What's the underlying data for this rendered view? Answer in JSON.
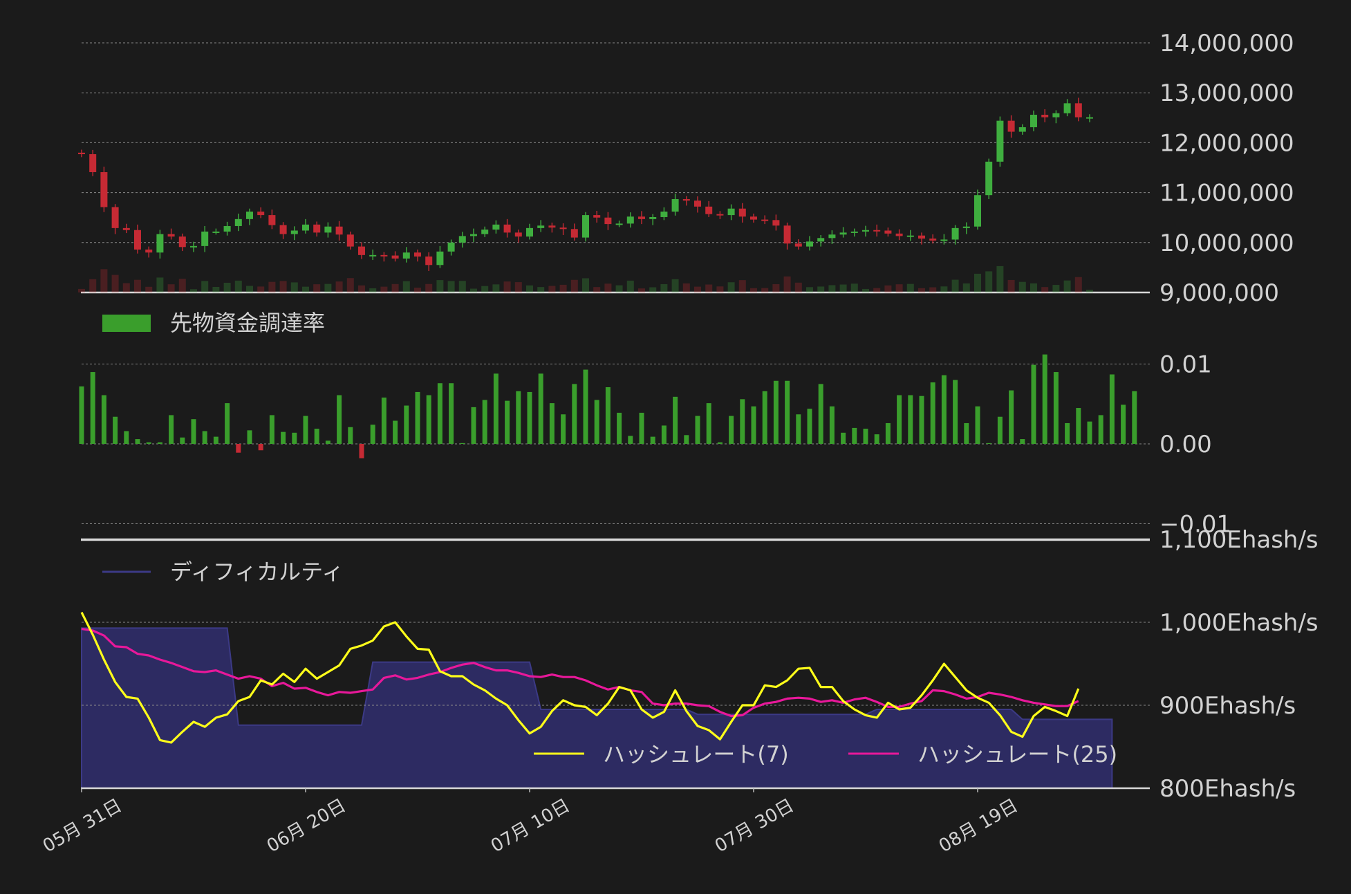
{
  "colors": {
    "background": "#1b1b1b",
    "up": "#3fae3f",
    "down": "#c62a34",
    "funding": "#3a9e2c",
    "difficulty_fill": "#2d2b62",
    "difficulty_line": "#3c3a86",
    "hash7": "#ffff1a",
    "hash25": "#e8189a"
  },
  "chart_data": [
    {
      "type": "candlestick",
      "x": {
        "start": "05月 31日",
        "count": 91
      },
      "y_ticks": [
        "9,000,000",
        "10,000,000",
        "11,000,000",
        "12,000,000",
        "13,000,000",
        "14,000,000"
      ],
      "ylim": [
        9000000,
        14000000
      ],
      "grid": true,
      "ohlc_close": [
        11770000,
        11410000,
        10710000,
        10290000,
        10250000,
        9860000,
        9800000,
        10170000,
        10120000,
        9910000,
        9930000,
        10220000,
        10220000,
        10330000,
        10470000,
        10620000,
        10550000,
        10350000,
        10170000,
        10240000,
        10360000,
        10200000,
        10320000,
        10160000,
        9920000,
        9750000,
        9750000,
        9740000,
        9680000,
        9800000,
        9720000,
        9550000,
        9820000,
        10000000,
        10130000,
        10170000,
        10260000,
        10360000,
        10200000,
        10120000,
        10290000,
        10340000,
        10300000,
        10270000,
        10100000,
        10550000,
        10500000,
        10370000,
        10380000,
        10520000,
        10470000,
        10510000,
        10620000,
        10870000,
        10840000,
        10720000,
        10570000,
        10550000,
        10680000,
        10520000,
        10460000,
        10450000,
        10340000,
        9980000,
        9920000,
        10020000,
        10090000,
        10160000,
        10200000,
        10220000,
        10250000,
        10240000,
        10180000,
        10130000,
        10140000,
        10080000,
        10040000,
        10060000,
        10290000,
        10320000,
        10950000,
        11620000,
        12440000,
        12220000,
        12310000,
        12560000,
        12510000,
        12590000,
        12790000,
        12510000,
        12510000
      ]
    },
    {
      "type": "bar",
      "legend": "先物資金調達率",
      "y_ticks": [
        "−0.01",
        "0.00",
        "0.01"
      ],
      "ylim": [
        -0.01,
        0.01
      ],
      "values": [
        0.0072,
        0.009,
        0.0061,
        0.0034,
        0.0016,
        0.0006,
        0.0002,
        0.0002,
        0.0036,
        0.0008,
        0.0031,
        0.0016,
        0.0009,
        0.0051,
        -0.0011,
        0.0017,
        -0.0008,
        0.0036,
        0.0015,
        0.0014,
        0.0035,
        0.0019,
        0.0004,
        0.0061,
        0.0021,
        -0.0018,
        0.0024,
        0.0058,
        0.0029,
        0.0048,
        0.0065,
        0.0061,
        0.0076,
        0.0076,
        0.0001,
        0.0046,
        0.0055,
        0.0088,
        0.0054,
        0.0066,
        0.0065,
        0.0088,
        0.0051,
        0.0037,
        0.0075,
        0.0093,
        0.0055,
        0.0071,
        0.0039,
        0.001,
        0.0039,
        0.0009,
        0.0023,
        0.0059,
        0.0011,
        0.0035,
        0.0051,
        0.0002,
        0.0035,
        0.0056,
        0.0047,
        0.0066,
        0.0079,
        0.0079,
        0.0037,
        0.0044,
        0.0075,
        0.0047,
        0.0014,
        0.002,
        0.0019,
        0.0012,
        0.0026,
        0.0061,
        0.0061,
        0.006,
        0.0077,
        0.0086,
        0.008,
        0.0026,
        0.0047,
        0.0001,
        0.0034,
        0.0067,
        0.0006,
        0.0099,
        0.0112,
        0.009,
        0.0026,
        0.0045,
        0.0028,
        0.0036,
        0.0087,
        0.0049,
        0.0066
      ]
    },
    {
      "type": "line+area",
      "y_ticks": [
        "800Ehash/s",
        "900Ehash/s",
        "1,000Ehash/s",
        "1,100Ehash/s"
      ],
      "ylim": [
        800,
        1100
      ],
      "x_ticks": [
        "05月 31日",
        "06月 20日",
        "07月 10日",
        "07月 30日",
        "08月 19日"
      ],
      "series": [
        {
          "name": "ディフィカルティ",
          "type": "area",
          "values": [
            993,
            993,
            993,
            993,
            993,
            993,
            993,
            993,
            993,
            993,
            993,
            993,
            993,
            993,
            876,
            876,
            876,
            876,
            876,
            876,
            876,
            876,
            876,
            876,
            876,
            876,
            952,
            952,
            952,
            952,
            952,
            952,
            952,
            952,
            952,
            952,
            952,
            952,
            952,
            952,
            952,
            895,
            895,
            895,
            895,
            895,
            895,
            895,
            895,
            895,
            895,
            895,
            895,
            895,
            895,
            889,
            889,
            889,
            889,
            889,
            889,
            889,
            889,
            889,
            889,
            889,
            889,
            889,
            889,
            889,
            889,
            895,
            895,
            895,
            895,
            895,
            895,
            895,
            895,
            895,
            895,
            895,
            895,
            895,
            883,
            883,
            883,
            883,
            883,
            883,
            883,
            883,
            883
          ]
        },
        {
          "name": "ハッシュレート(7)",
          "values": [
            1012,
            985,
            955,
            928,
            910,
            908,
            885,
            858,
            855,
            868,
            880,
            874,
            885,
            889,
            905,
            910,
            930,
            925,
            938,
            928,
            944,
            932,
            940,
            948,
            968,
            972,
            978,
            995,
            1000,
            983,
            968,
            967,
            941,
            935,
            935,
            925,
            918,
            908,
            900,
            882,
            866,
            874,
            893,
            906,
            900,
            898,
            888,
            902,
            922,
            918,
            895,
            885,
            892,
            918,
            893,
            875,
            870,
            859,
            880,
            900,
            900,
            924,
            922,
            930,
            944,
            945,
            922,
            922,
            905,
            895,
            888,
            885,
            903,
            895,
            897,
            912,
            930,
            950,
            934,
            918,
            909,
            903,
            888,
            868,
            862,
            887,
            898,
            893,
            887,
            920
          ]
        },
        {
          "name": "ハッシュレート(25)",
          "values": [
            992,
            990,
            984,
            971,
            970,
            962,
            960,
            955,
            951,
            946,
            941,
            940,
            942,
            937,
            932,
            935,
            932,
            923,
            927,
            920,
            921,
            916,
            912,
            916,
            915,
            917,
            919,
            933,
            936,
            931,
            933,
            937,
            940,
            945,
            949,
            951,
            946,
            942,
            942,
            939,
            935,
            934,
            937,
            934,
            934,
            930,
            924,
            919,
            922,
            918,
            916,
            902,
            900,
            902,
            902,
            900,
            899,
            892,
            887,
            888,
            897,
            902,
            904,
            908,
            909,
            908,
            904,
            906,
            903,
            907,
            909,
            904,
            898,
            898,
            902,
            905,
            918,
            917,
            913,
            908,
            910,
            915,
            913,
            910,
            906,
            903,
            901,
            899,
            899,
            905
          ]
        }
      ]
    }
  ]
}
